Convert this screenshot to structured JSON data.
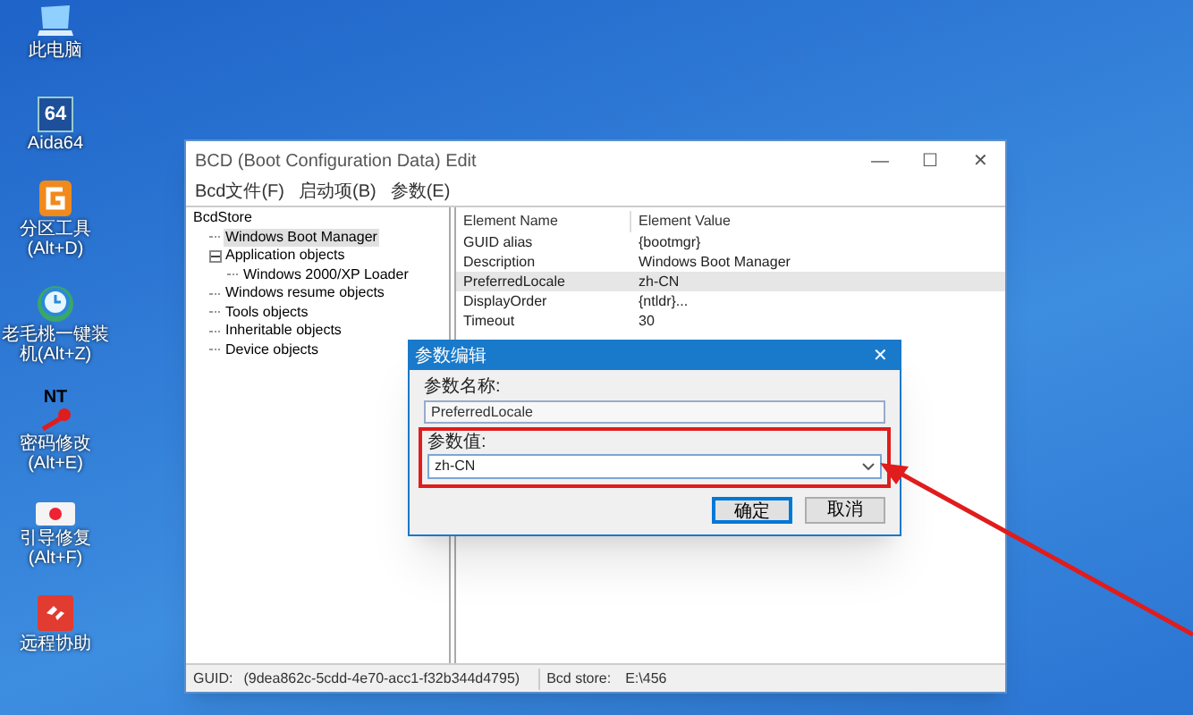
{
  "desktop_icons": [
    {
      "kind": "pc",
      "label": "此电脑"
    },
    {
      "kind": "aida",
      "label": "Aida64",
      "glyph": "64"
    },
    {
      "kind": "partition",
      "label": "分区工具(Alt+D)"
    },
    {
      "kind": "installer",
      "label": "老毛桃一键装机(Alt+Z)"
    },
    {
      "kind": "password",
      "label": "密码修改(Alt+E)",
      "glyph": "NT"
    },
    {
      "kind": "repair",
      "label": "引导修复(Alt+F)"
    },
    {
      "kind": "remote",
      "label": "远程协助"
    }
  ],
  "window": {
    "title": "BCD (Boot Configuration Data) Edit",
    "controls": [
      "—",
      "☐",
      "✕"
    ]
  },
  "menu": [
    "Bcd文件(F)",
    "启动项(B)",
    "参数(E)"
  ],
  "tree": {
    "label": "BcdStore",
    "selected": false,
    "children": [
      {
        "label": "Windows Boot Manager",
        "selected": true
      },
      {
        "label": "Application objects",
        "selected": false,
        "expanded": true,
        "children": [
          {
            "label": "Windows 2000/XP Loader",
            "selected": false
          }
        ]
      },
      {
        "label": "Windows resume objects",
        "selected": false
      },
      {
        "label": "Tools objects",
        "selected": false
      },
      {
        "label": "Inheritable objects",
        "selected": false
      },
      {
        "label": "Device objects",
        "selected": false
      }
    ]
  },
  "table": {
    "columns": [
      "Element Name",
      "Element Value"
    ],
    "rows": [
      {
        "cells": [
          "GUID alias",
          "{bootmgr}"
        ],
        "selected": false
      },
      {
        "cells": [
          "Description",
          "Windows Boot Manager"
        ],
        "selected": false
      },
      {
        "cells": [
          "PreferredLocale",
          "zh-CN"
        ],
        "selected": true
      },
      {
        "cells": [
          "DisplayOrder",
          "{ntldr}..."
        ],
        "selected": false
      },
      {
        "cells": [
          "Timeout",
          "30"
        ],
        "selected": false
      }
    ]
  },
  "status_bar": [
    "GUID:",
    "(9dea862c-5cdd-4e70-acc1-f32b344d4795)",
    "Bcd store:",
    "E:\\456"
  ],
  "dialog": {
    "title": "参数编辑",
    "close": "✕",
    "name_label": "参数名称:",
    "name_value": "PreferredLocale",
    "value_label": "参数值:",
    "value": "zh-CN",
    "buttons": [
      {
        "label": "确定",
        "selected": true
      },
      {
        "label": "取消",
        "selected": false
      }
    ]
  }
}
